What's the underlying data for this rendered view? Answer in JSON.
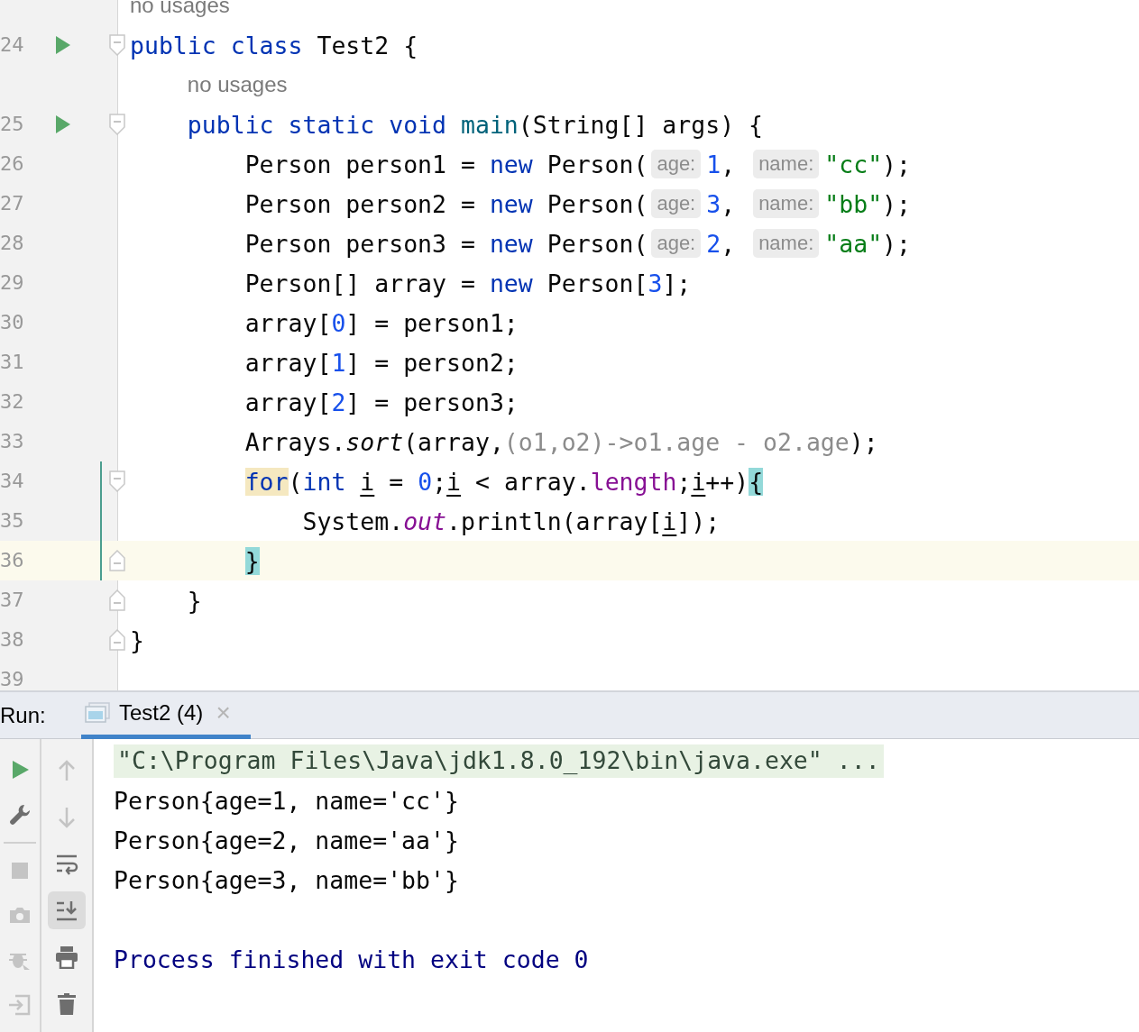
{
  "editor": {
    "lines": [
      {
        "kind": "inlay",
        "text": "no usages"
      },
      {
        "kind": "code",
        "number": "24",
        "run": true,
        "fold_marker": {
          "kind": "start"
        },
        "modified": false,
        "current": false,
        "tokens": [
          {
            "kind": "keyword",
            "text": "public class"
          },
          {
            "kind": "plain",
            "text": " Test2 {"
          }
        ]
      },
      {
        "kind": "inlay",
        "text": "no usages"
      },
      {
        "kind": "code",
        "number": "25",
        "run": true,
        "fold_marker": {
          "kind": "start"
        },
        "modified": false,
        "current": false,
        "tokens": [
          {
            "kind": "keyword",
            "text": "    public static void "
          },
          {
            "kind": "method",
            "text": "main"
          },
          {
            "kind": "plain",
            "text": "(String[] args) {"
          }
        ]
      },
      {
        "kind": "code",
        "number": "26",
        "run": false,
        "modified": false,
        "current": false,
        "tokens": [
          {
            "kind": "plain",
            "text": "        Person person1 = "
          },
          {
            "kind": "keyword",
            "text": "new"
          },
          {
            "kind": "plain",
            "text": " Person("
          },
          {
            "kind": "hint",
            "text": "age:"
          },
          {
            "kind": "number",
            "text": "1"
          },
          {
            "kind": "plain",
            "text": ", "
          },
          {
            "kind": "hint",
            "text": "name:"
          },
          {
            "kind": "string",
            "text": "\"cc\""
          },
          {
            "kind": "plain",
            "text": ");"
          }
        ]
      },
      {
        "kind": "code",
        "number": "27",
        "run": false,
        "modified": false,
        "current": false,
        "tokens": [
          {
            "kind": "plain",
            "text": "        Person person2 = "
          },
          {
            "kind": "keyword",
            "text": "new"
          },
          {
            "kind": "plain",
            "text": " Person("
          },
          {
            "kind": "hint",
            "text": "age:"
          },
          {
            "kind": "number",
            "text": "3"
          },
          {
            "kind": "plain",
            "text": ", "
          },
          {
            "kind": "hint",
            "text": "name:"
          },
          {
            "kind": "string",
            "text": "\"bb\""
          },
          {
            "kind": "plain",
            "text": ");"
          }
        ]
      },
      {
        "kind": "code",
        "number": "28",
        "run": false,
        "modified": false,
        "current": false,
        "tokens": [
          {
            "kind": "plain",
            "text": "        Person person3 = "
          },
          {
            "kind": "keyword",
            "text": "new"
          },
          {
            "kind": "plain",
            "text": " Person("
          },
          {
            "kind": "hint",
            "text": "age:"
          },
          {
            "kind": "number",
            "text": "2"
          },
          {
            "kind": "plain",
            "text": ", "
          },
          {
            "kind": "hint",
            "text": "name:"
          },
          {
            "kind": "string",
            "text": "\"aa\""
          },
          {
            "kind": "plain",
            "text": ");"
          }
        ]
      },
      {
        "kind": "code",
        "number": "29",
        "run": false,
        "modified": false,
        "current": false,
        "tokens": [
          {
            "kind": "plain",
            "text": "        Person[] array = "
          },
          {
            "kind": "keyword",
            "text": "new"
          },
          {
            "kind": "plain",
            "text": " Person["
          },
          {
            "kind": "number",
            "text": "3"
          },
          {
            "kind": "plain",
            "text": "];"
          }
        ]
      },
      {
        "kind": "code",
        "number": "30",
        "run": false,
        "modified": false,
        "current": false,
        "tokens": [
          {
            "kind": "plain",
            "text": "        array["
          },
          {
            "kind": "number",
            "text": "0"
          },
          {
            "kind": "plain",
            "text": "] = person1;"
          }
        ]
      },
      {
        "kind": "code",
        "number": "31",
        "run": false,
        "modified": false,
        "current": false,
        "tokens": [
          {
            "kind": "plain",
            "text": "        array["
          },
          {
            "kind": "number",
            "text": "1"
          },
          {
            "kind": "plain",
            "text": "] = person2;"
          }
        ]
      },
      {
        "kind": "code",
        "number": "32",
        "run": false,
        "modified": false,
        "current": false,
        "tokens": [
          {
            "kind": "plain",
            "text": "        array["
          },
          {
            "kind": "number",
            "text": "2"
          },
          {
            "kind": "plain",
            "text": "] = person3;"
          }
        ]
      },
      {
        "kind": "code",
        "number": "33",
        "run": false,
        "modified": false,
        "current": false,
        "tokens": [
          {
            "kind": "plain",
            "text": "        Arrays."
          },
          {
            "kind": "static",
            "text": "sort"
          },
          {
            "kind": "plain",
            "text": "(array,"
          },
          {
            "kind": "dim",
            "text": "(o1,o2)->o1.age - o2.age"
          },
          {
            "kind": "plain",
            "text": ");"
          }
        ]
      },
      {
        "kind": "code",
        "number": "34",
        "run": false,
        "fold_marker": {
          "kind": "start"
        },
        "modified": true,
        "current": false,
        "tokens": [
          {
            "kind": "keyword-match",
            "text": "        for"
          },
          {
            "kind": "plain",
            "text": "("
          },
          {
            "kind": "keyword",
            "text": "int "
          },
          {
            "kind": "var",
            "text": "i"
          },
          {
            "kind": "plain",
            "text": " = "
          },
          {
            "kind": "number",
            "text": "0"
          },
          {
            "kind": "plain",
            "text": ";"
          },
          {
            "kind": "var",
            "text": "i"
          },
          {
            "kind": "plain",
            "text": " < array."
          },
          {
            "kind": "field",
            "text": "length"
          },
          {
            "kind": "plain",
            "text": ";"
          },
          {
            "kind": "var",
            "text": "i"
          },
          {
            "kind": "plain",
            "text": "++)"
          },
          {
            "kind": "brace-match",
            "text": "{"
          }
        ]
      },
      {
        "kind": "code",
        "number": "35",
        "run": false,
        "modified": true,
        "current": false,
        "tokens": [
          {
            "kind": "plain",
            "text": "            System."
          },
          {
            "kind": "static-field",
            "text": "out"
          },
          {
            "kind": "plain",
            "text": ".println(array["
          },
          {
            "kind": "var",
            "text": "i"
          },
          {
            "kind": "plain",
            "text": "]);"
          }
        ]
      },
      {
        "kind": "code",
        "number": "36",
        "run": false,
        "fold_marker": {
          "kind": "end"
        },
        "modified": true,
        "current": true,
        "tokens": [
          {
            "kind": "brace-match",
            "text": "        }"
          }
        ]
      },
      {
        "kind": "code",
        "number": "37",
        "run": false,
        "fold_marker": {
          "kind": "end"
        },
        "modified": false,
        "current": false,
        "tokens": [
          {
            "kind": "plain",
            "text": "    }"
          }
        ]
      },
      {
        "kind": "code",
        "number": "38",
        "run": false,
        "fold_marker": {
          "kind": "end"
        },
        "modified": false,
        "current": false,
        "tokens": [
          {
            "kind": "plain",
            "text": "}"
          }
        ]
      },
      {
        "kind": "code",
        "number": "39",
        "run": false,
        "modified": false,
        "current": false
      }
    ]
  },
  "run": {
    "label": "Run:",
    "tabs": [
      {
        "title": "Test2 (4)",
        "close": "×",
        "selected": true
      }
    ],
    "left_tools": [
      {
        "disabled": false
      },
      {
        "disabled": false
      },
      {
        "disabled": true
      },
      {
        "disabled": true
      },
      {
        "disabled": true
      },
      {
        "disabled": true
      }
    ],
    "right_tools": [
      {
        "disabled": true,
        "toggled": false
      },
      {
        "disabled": true,
        "toggled": false
      },
      {
        "disabled": false,
        "toggled": false
      },
      {
        "disabled": false,
        "toggled": true
      },
      {
        "disabled": false,
        "toggled": false
      },
      {
        "disabled": false,
        "toggled": false
      }
    ],
    "output": [
      {
        "kind": "command",
        "text": "\"C:\\Program Files\\Java\\jdk1.8.0_192\\bin\\java.exe\" ..."
      },
      {
        "kind": "stdout",
        "text": "Person{age=1, name='cc'}"
      },
      {
        "kind": "stdout",
        "text": "Person{age=2, name='aa'}"
      },
      {
        "kind": "stdout",
        "text": "Person{age=3, name='bb'}"
      },
      {
        "kind": "blank"
      },
      {
        "kind": "exit",
        "text": "Process finished with exit code 0"
      }
    ]
  }
}
